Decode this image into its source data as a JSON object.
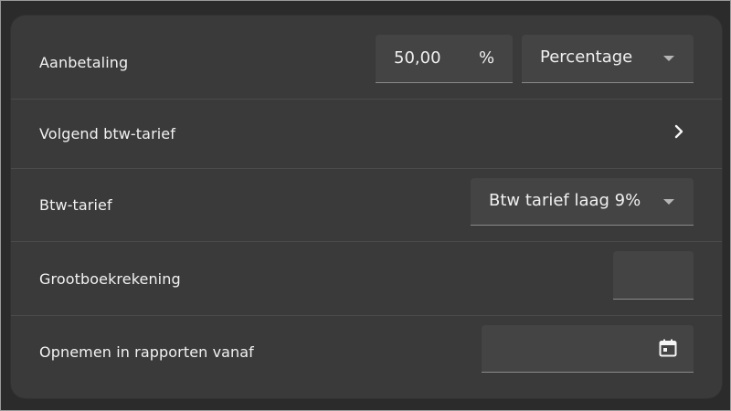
{
  "rows": [
    {
      "label": "Aanbetaling",
      "amount_value": "50,00",
      "amount_suffix": "%",
      "type_select_value": "Percentage"
    },
    {
      "label": "Volgend btw-tarief"
    },
    {
      "label": "Btw-tarief",
      "select_value": "Btw tarief laag 9%"
    },
    {
      "label": "Grootboekrekening",
      "input_value": ""
    },
    {
      "label": "Opnemen in rapporten vanaf",
      "date_value": ""
    }
  ],
  "icons": {
    "chevron": "chevron-right-icon",
    "calendar": "calendar-icon",
    "dropdown": "chevron-down-icon"
  }
}
